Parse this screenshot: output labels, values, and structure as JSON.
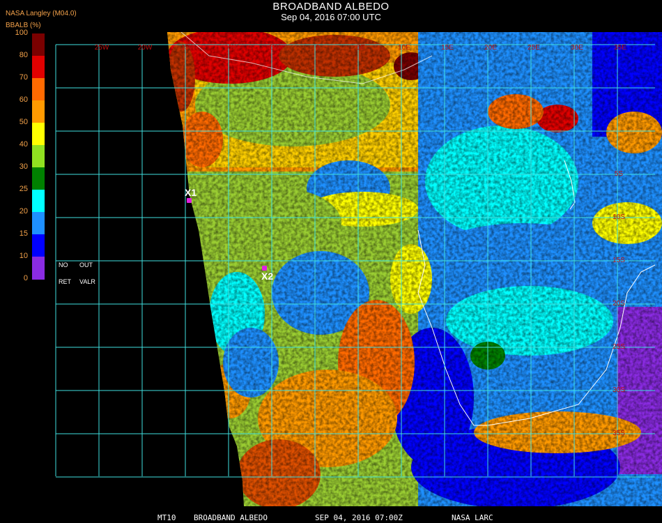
{
  "header": {
    "title": "BROADBAND ALBEDO",
    "datetime": "Sep 04, 2016 07:00 UTC",
    "provider": "NASA Langley (M04.0)"
  },
  "colorbar": {
    "label": "BBALB (%)",
    "ticks": [
      "100",
      "80",
      "70",
      "60",
      "50",
      "40",
      "30",
      "25",
      "20",
      "15",
      "10",
      "0"
    ],
    "colors": [
      "#7a0000",
      "#e00000",
      "#ff6a00",
      "#ff9a00",
      "#ffff00",
      "#90e020",
      "#008000",
      "#00ffff",
      "#1e90ff",
      "#0000ff",
      "#8a2be2"
    ],
    "no_data": "NO",
    "out_data": "OUT",
    "no_retrieval": "RET",
    "out_value": "VALR"
  },
  "map": {
    "longitude_labels": [
      "25W",
      "20W",
      "15W",
      "10W",
      "5W",
      "0",
      "5E",
      "10E",
      "15E",
      "20E",
      "25E",
      "30E",
      "35E"
    ],
    "latitude_labels": [
      "5S",
      "10S",
      "15S",
      "20S",
      "25S",
      "30S",
      "35S"
    ],
    "grid_color": "#40e0e0",
    "markers": [
      {
        "label": "X1"
      },
      {
        "label": "X2"
      }
    ]
  },
  "footer": {
    "product": "MT10",
    "name": "BROADBAND ALBEDO",
    "date": "SEP 04, 2016 07:00Z",
    "source": "NASA LARC"
  }
}
